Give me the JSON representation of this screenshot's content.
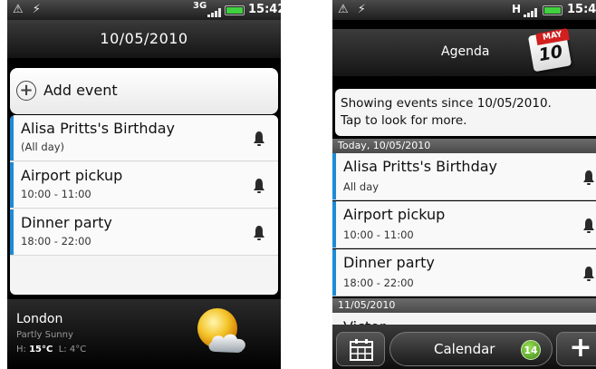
{
  "left_screen": {
    "status_bar": {
      "notification_icons": "⚠ ⚡",
      "network": "3G",
      "time": "15:42"
    },
    "header": {
      "date": "10/05/2010"
    },
    "add_event": {
      "label": "Add event"
    },
    "events": [
      {
        "title": "Alisa Pritts's Birthday",
        "time": "(All day)",
        "reminder_icon": "bell-icon"
      },
      {
        "title": "Airport pickup",
        "time": "10:00 - 11:00",
        "reminder_icon": "bell-icon"
      },
      {
        "title": "Dinner party",
        "time": "18:00 - 22:00",
        "reminder_icon": "bell-icon"
      }
    ],
    "weather": {
      "city": "London",
      "condition": "Partly Sunny",
      "high_label": "H:",
      "high": "15°C",
      "low_label": "L:",
      "low": "4°C",
      "icon": "partly-sunny-icon"
    }
  },
  "right_screen": {
    "status_bar": {
      "notification_icons": "⚠ ⚡",
      "network": "H",
      "time": "15:4"
    },
    "header": {
      "title": "Agenda",
      "calendar_icon_month": "MAY",
      "calendar_icon_day": "10"
    },
    "notice": {
      "line1": "Showing events since 10/05/2010.",
      "line2": "Tap to look for more."
    },
    "sections": [
      {
        "label": "Today, 10/05/2010",
        "events": [
          {
            "title": "Alisa Pritts's Birthday",
            "time": "All day"
          },
          {
            "title": "Airport pickup",
            "time": "10:00 - 11:00"
          },
          {
            "title": "Dinner party",
            "time": "18:00 - 22:00"
          }
        ]
      },
      {
        "label": "11/05/2010",
        "events": [
          {
            "title": "Victor ..."
          }
        ]
      }
    ],
    "bottom_bar": {
      "calendar_label": "Calendar",
      "badge_count": "14"
    }
  },
  "colors": {
    "event_bar": "#1e8bd6",
    "battery": "#3fd13f",
    "badge": "#4a9a1c",
    "calendar_tab": "#d21f1f"
  }
}
